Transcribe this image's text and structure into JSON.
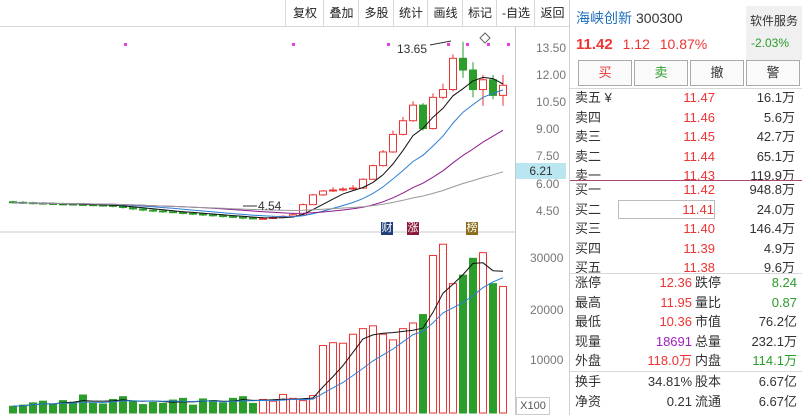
{
  "toolbar": {
    "buttons": [
      "复权",
      "叠加",
      "多股",
      "统计",
      "画线",
      "标记",
      "-自选",
      "返回"
    ]
  },
  "chart": {
    "price_ticks": [
      "13.50",
      "12.00",
      "10.50",
      "9.00",
      "7.50",
      "6.00",
      "4.50"
    ],
    "volume_ticks": [
      "30000",
      "20000",
      "10000"
    ],
    "current_price_tag": "6.21",
    "volume_unit": "X100",
    "annotation_high": "13.65",
    "annotation_low": "4.54",
    "marks": [
      "财",
      "涨",
      "榜"
    ],
    "colors": {
      "up": "#e33",
      "down": "#2a9d2a",
      "ma5": "#111",
      "ma10": "#2a7fd4",
      "ma20": "#8b1a8b",
      "ma60": "#999"
    }
  },
  "chart_data": {
    "type": "candlestick",
    "candles": [
      {
        "o": 5.45,
        "c": 5.4,
        "h": 5.5,
        "l": 5.35
      },
      {
        "o": 5.42,
        "c": 5.38,
        "h": 5.48,
        "l": 5.33
      },
      {
        "o": 5.4,
        "c": 5.36,
        "h": 5.45,
        "l": 5.31
      },
      {
        "o": 5.38,
        "c": 5.35,
        "h": 5.43,
        "l": 5.3
      },
      {
        "o": 5.36,
        "c": 5.33,
        "h": 5.41,
        "l": 5.28
      },
      {
        "o": 5.34,
        "c": 5.32,
        "h": 5.4,
        "l": 5.27
      },
      {
        "o": 5.33,
        "c": 5.3,
        "h": 5.38,
        "l": 5.25
      },
      {
        "o": 5.31,
        "c": 5.29,
        "h": 5.37,
        "l": 5.24
      },
      {
        "o": 5.3,
        "c": 5.27,
        "h": 5.36,
        "l": 5.22
      },
      {
        "o": 5.28,
        "c": 5.25,
        "h": 5.34,
        "l": 5.2
      },
      {
        "o": 5.26,
        "c": 5.22,
        "h": 5.32,
        "l": 5.16
      },
      {
        "o": 5.23,
        "c": 5.15,
        "h": 5.28,
        "l": 5.1
      },
      {
        "o": 5.15,
        "c": 5.08,
        "h": 5.2,
        "l": 5.02
      },
      {
        "o": 5.08,
        "c": 5.02,
        "h": 5.14,
        "l": 4.96
      },
      {
        "o": 5.02,
        "c": 4.98,
        "h": 5.08,
        "l": 4.92
      },
      {
        "o": 4.98,
        "c": 4.94,
        "h": 5.04,
        "l": 4.88
      },
      {
        "o": 4.94,
        "c": 4.9,
        "h": 5.0,
        "l": 4.85
      },
      {
        "o": 4.9,
        "c": 4.86,
        "h": 4.96,
        "l": 4.8
      },
      {
        "o": 4.86,
        "c": 4.82,
        "h": 4.92,
        "l": 4.76
      },
      {
        "o": 4.82,
        "c": 4.78,
        "h": 4.88,
        "l": 4.72
      },
      {
        "o": 4.78,
        "c": 4.74,
        "h": 4.84,
        "l": 4.68
      },
      {
        "o": 4.74,
        "c": 4.7,
        "h": 4.8,
        "l": 4.64
      },
      {
        "o": 4.7,
        "c": 4.66,
        "h": 4.76,
        "l": 4.6
      },
      {
        "o": 4.66,
        "c": 4.62,
        "h": 4.72,
        "l": 4.56
      },
      {
        "o": 4.62,
        "c": 4.58,
        "h": 4.68,
        "l": 4.54
      },
      {
        "o": 4.58,
        "c": 4.6,
        "h": 4.66,
        "l": 4.54
      },
      {
        "o": 4.6,
        "c": 4.64,
        "h": 4.7,
        "l": 4.56
      },
      {
        "o": 4.64,
        "c": 4.7,
        "h": 4.76,
        "l": 4.6
      },
      {
        "o": 4.7,
        "c": 4.78,
        "h": 4.84,
        "l": 4.66
      },
      {
        "o": 4.78,
        "c": 5.3,
        "h": 5.35,
        "l": 4.76
      },
      {
        "o": 5.3,
        "c": 5.8,
        "h": 5.85,
        "l": 5.28
      },
      {
        "o": 5.8,
        "c": 6.0,
        "h": 6.05,
        "l": 5.75
      },
      {
        "o": 6.0,
        "c": 6.05,
        "h": 6.2,
        "l": 5.95
      },
      {
        "o": 6.05,
        "c": 6.1,
        "h": 6.2,
        "l": 5.98
      },
      {
        "o": 6.1,
        "c": 6.15,
        "h": 6.3,
        "l": 6.05
      },
      {
        "o": 6.15,
        "c": 6.6,
        "h": 6.65,
        "l": 6.1
      },
      {
        "o": 6.6,
        "c": 7.3,
        "h": 7.35,
        "l": 6.58
      },
      {
        "o": 7.3,
        "c": 8.0,
        "h": 8.1,
        "l": 7.25
      },
      {
        "o": 8.0,
        "c": 8.9,
        "h": 9.1,
        "l": 7.95
      },
      {
        "o": 8.9,
        "c": 9.6,
        "h": 9.8,
        "l": 8.85
      },
      {
        "o": 9.6,
        "c": 10.4,
        "h": 10.6,
        "l": 9.55
      },
      {
        "o": 10.4,
        "c": 9.2,
        "h": 10.5,
        "l": 9.1
      },
      {
        "o": 9.2,
        "c": 10.8,
        "h": 11.0,
        "l": 9.15
      },
      {
        "o": 10.8,
        "c": 11.2,
        "h": 11.5,
        "l": 10.7
      },
      {
        "o": 11.2,
        "c": 12.8,
        "h": 13.0,
        "l": 11.1
      },
      {
        "o": 12.8,
        "c": 12.2,
        "h": 13.65,
        "l": 11.8
      },
      {
        "o": 12.2,
        "c": 11.2,
        "h": 12.6,
        "l": 10.8
      },
      {
        "o": 11.2,
        "c": 11.7,
        "h": 11.95,
        "l": 10.36
      },
      {
        "o": 11.7,
        "c": 10.9,
        "h": 11.95,
        "l": 10.7
      },
      {
        "o": 10.9,
        "c": 11.42,
        "h": 11.95,
        "l": 10.36
      }
    ],
    "volumes": [
      1200,
      1400,
      1800,
      2100,
      1600,
      2200,
      1900,
      3200,
      1700,
      1600,
      2400,
      2900,
      2100,
      1500,
      1900,
      1700,
      2300,
      2600,
      1400,
      2500,
      2200,
      1800,
      2600,
      2900,
      1700,
      2400,
      2100,
      3300,
      2600,
      2200,
      3100,
      12000,
      12500,
      12400,
      14000,
      15000,
      15500,
      14000,
      13000,
      15000,
      16000,
      17500,
      28000,
      30000,
      23000,
      24500,
      27500,
      28500,
      23000,
      22500
    ],
    "ylim_price": [
      4.0,
      14.2
    ],
    "ylim_volume": [
      0,
      32000
    ]
  },
  "panel": {
    "name": "海峡创新",
    "code": "300300",
    "price": "11.42",
    "change": "1.12",
    "change_pct": "10.87%",
    "service_label": "软件服务",
    "service_pct": "-2.03%",
    "actions": [
      "买",
      "卖",
      "撤",
      "警"
    ],
    "sell": [
      {
        "label": "卖五 ¥",
        "price": "11.47",
        "vol": "16.1万"
      },
      {
        "label": "卖四",
        "price": "11.46",
        "vol": "5.6万"
      },
      {
        "label": "卖三",
        "price": "11.45",
        "vol": "42.7万"
      },
      {
        "label": "卖二",
        "price": "11.44",
        "vol": "65.1万"
      },
      {
        "label": "卖一",
        "price": "11.43",
        "vol": "119.9万"
      }
    ],
    "buy": [
      {
        "label": "买一",
        "price": "11.42",
        "vol": "948.8万"
      },
      {
        "label": "买二",
        "price": "11.41",
        "vol": "24.0万"
      },
      {
        "label": "买三",
        "price": "11.40",
        "vol": "146.4万"
      },
      {
        "label": "买四",
        "price": "11.39",
        "vol": "4.9万"
      },
      {
        "label": "买五",
        "price": "11.38",
        "vol": "9.6万"
      }
    ],
    "stats": [
      {
        "l": "涨停",
        "v": "12.36",
        "vc": "red",
        "l2": "跌停",
        "v2": "8.24",
        "v2c": "green"
      },
      {
        "l": "最高",
        "v": "11.95",
        "vc": "red",
        "l2": "量比",
        "v2": "0.87",
        "v2c": "green"
      },
      {
        "l": "最低",
        "v": "10.36",
        "vc": "red",
        "l2": "市值",
        "v2": "76.2亿",
        "v2c": ""
      },
      {
        "l": "现量",
        "v": "18691",
        "vc": "purple",
        "l2": "总量",
        "v2": "232.1万",
        "v2c": ""
      },
      {
        "l": "外盘",
        "v": "118.0万",
        "vc": "red",
        "l2": "内盘",
        "v2": "114.1万",
        "v2c": "green"
      }
    ],
    "stats2": [
      {
        "l": "换手",
        "v": "34.81%",
        "vc": "",
        "l2": "股本",
        "v2": "6.67亿",
        "v2c": ""
      },
      {
        "l": "净资",
        "v": "0.21",
        "vc": "",
        "l2": "流通",
        "v2": "6.67亿",
        "v2c": ""
      }
    ]
  }
}
